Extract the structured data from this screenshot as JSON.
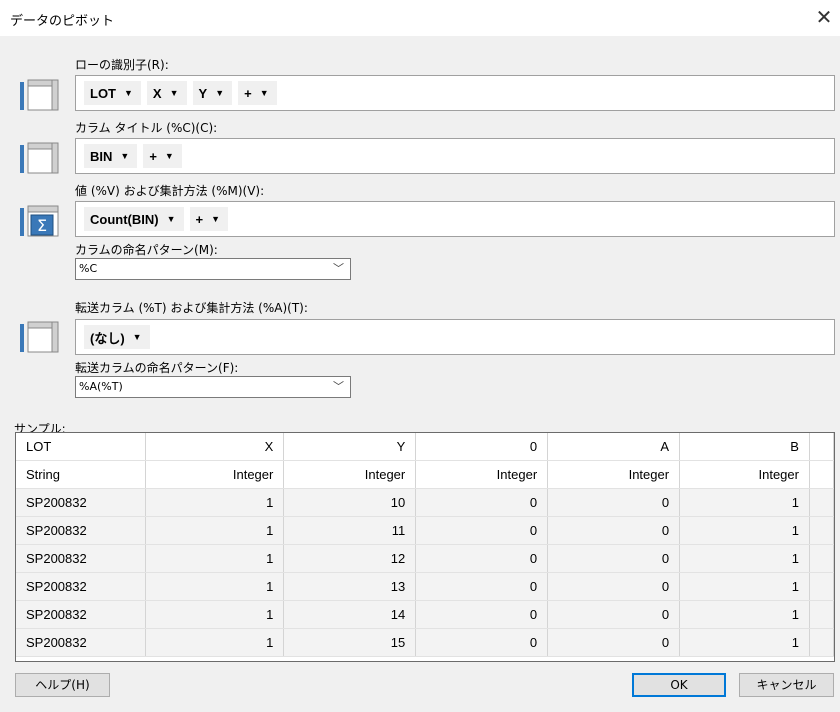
{
  "window": {
    "title": "データのピボット",
    "close_glyph": "✕"
  },
  "rows": {
    "label": "ローの識別子(R):",
    "chips": [
      "LOT",
      "X",
      "Y",
      "+"
    ]
  },
  "columns": {
    "label": "カラム タイトル (%C)(C):",
    "chips": [
      "BIN",
      "+"
    ]
  },
  "values": {
    "label": "値 (%V) および集計方法 (%M)(V):",
    "chips": [
      "Count(BIN)",
      "+"
    ],
    "naming_label": "カラムの命名パターン(M):",
    "naming_value": "%C"
  },
  "transfer": {
    "label": "転送カラム (%T) および集計方法 (%A)(T):",
    "chips": [
      "(なし)"
    ],
    "naming_label": "転送カラムの命名パターン(F):",
    "naming_value": "%A(%T)"
  },
  "sample": {
    "label": "サンプル:",
    "headers": [
      "LOT",
      "X",
      "Y",
      "0",
      "A",
      "B"
    ],
    "types": [
      "String",
      "Integer",
      "Integer",
      "Integer",
      "Integer",
      "Integer"
    ],
    "rows": [
      [
        "SP200832",
        "1",
        "10",
        "0",
        "0",
        "1"
      ],
      [
        "SP200832",
        "1",
        "11",
        "0",
        "0",
        "1"
      ],
      [
        "SP200832",
        "1",
        "12",
        "0",
        "0",
        "1"
      ],
      [
        "SP200832",
        "1",
        "13",
        "0",
        "0",
        "1"
      ],
      [
        "SP200832",
        "1",
        "14",
        "0",
        "0",
        "1"
      ],
      [
        "SP200832",
        "1",
        "15",
        "0",
        "0",
        "1"
      ]
    ]
  },
  "buttons": {
    "help": "ヘルプ(H)",
    "ok": "OK",
    "cancel": "キャンセル"
  },
  "colors": {
    "accent": "#0078d7",
    "icon_blue": "#3a78b8"
  }
}
